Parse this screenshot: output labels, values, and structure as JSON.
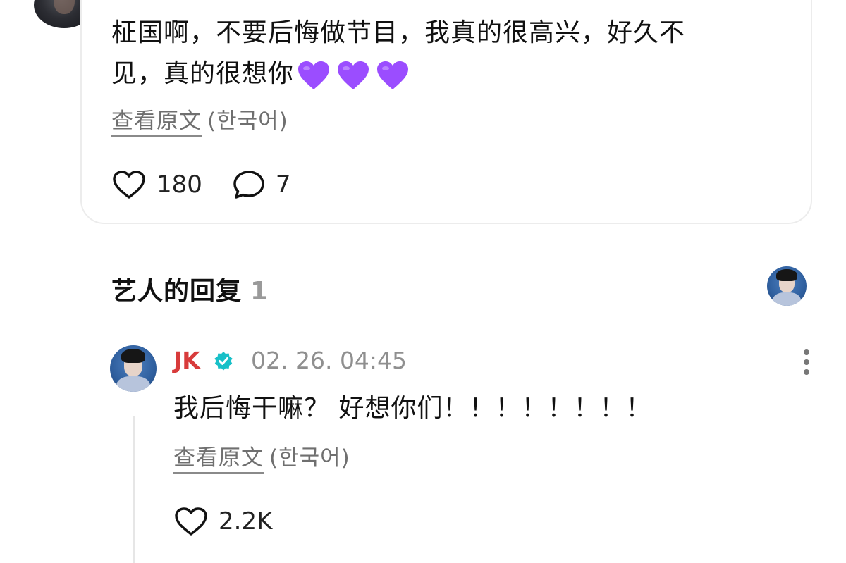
{
  "post": {
    "text_line1": "柾国啊，不要后悔做节目，我真的很高兴，好久不",
    "text_line2": "见，真的很想你",
    "heart_emoji": "purple-heart",
    "heart_color": "#9b4dff",
    "translate_link": "查看原文",
    "translate_lang": "(한국어)",
    "likes": "180",
    "comments": "7"
  },
  "artist_replies": {
    "title": "艺人的回复",
    "count": "1"
  },
  "reply": {
    "author": "JK",
    "author_color": "#d83b3b",
    "verified_color": "#18c0c8",
    "timestamp": "02. 26. 04:45",
    "text": "我后悔干嘛？ 好想你们！！！！！！！！",
    "translate_link": "查看原文",
    "translate_lang": "(한국어)",
    "likes": "2.2K"
  }
}
